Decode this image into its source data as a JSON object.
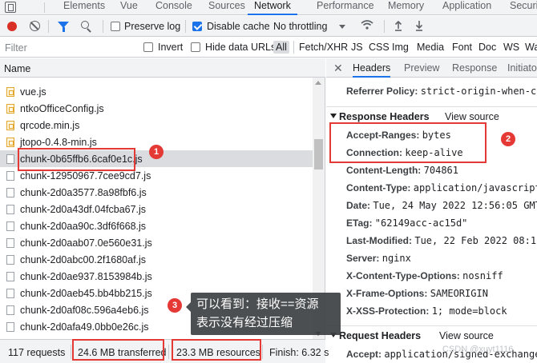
{
  "panel_tabs": [
    "Elements",
    "Vue",
    "Console",
    "Sources",
    "Network",
    "Performance",
    "Memory",
    "Application",
    "Securi"
  ],
  "toolbar": {
    "preserve_log": "Preserve log",
    "disable_cache": "Disable cache",
    "throttle": "No throttling"
  },
  "filterbar": {
    "placeholder": "Filter",
    "invert": "Invert",
    "hide_data_urls": "Hide data URLs",
    "types": [
      "All",
      "Fetch/XHR",
      "JS",
      "CSS",
      "Img",
      "Media",
      "Font",
      "Doc",
      "WS",
      "Wa"
    ]
  },
  "list": {
    "header": "Name",
    "rows": [
      "vue.js",
      "ntkoOfficeConfig.js",
      "qrcode.min.js",
      "jtopo-0.4.8-min.js",
      "chunk-0b65ffb6.6caf0e1c.js",
      "chunk-12950967.7cee9cd7.js",
      "chunk-2d0a3577.8a98fbf6.js",
      "chunk-2d0a43df.04fcba67.js",
      "chunk-2d0aa90c.3df6f668.js",
      "chunk-2d0aab07.0e560e31.js",
      "chunk-2d0abc00.2f1680af.js",
      "chunk-2d0ae937.8153984b.js",
      "chunk-2d0aeb45.bb4bb215.js",
      "chunk-2d0af08c.596a4eb6.js",
      "chunk-2d0afa49.0bb0e26c.js"
    ]
  },
  "status": {
    "requests": "117 requests",
    "transferred": "24.6 MB transferred",
    "resources": "23.3 MB resources",
    "finish": "Finish: 6.32 s"
  },
  "right": {
    "tabs": [
      "Headers",
      "Preview",
      "Response",
      "Initiator"
    ],
    "referrer_key": "Referrer Policy:",
    "referrer_val": "strict-origin-when-cro",
    "response_headers_title": "Response Headers",
    "view_source": "View source",
    "response_headers": [
      {
        "k": "Accept-Ranges:",
        "v": "bytes"
      },
      {
        "k": "Connection:",
        "v": "keep-alive"
      },
      {
        "k": "Content-Length:",
        "v": "704861"
      },
      {
        "k": "Content-Type:",
        "v": "application/javascript"
      },
      {
        "k": "Date:",
        "v": "Tue, 24 May 2022 12:56:05 GMT"
      },
      {
        "k": "ETag:",
        "v": "\"62149acc-ac15d\""
      },
      {
        "k": "Last-Modified:",
        "v": "Tue, 22 Feb 2022 08:11:"
      },
      {
        "k": "Server:",
        "v": "nginx"
      },
      {
        "k": "X-Content-Type-Options:",
        "v": "nosniff"
      },
      {
        "k": "X-Frame-Options:",
        "v": "SAMEORIGIN"
      },
      {
        "k": "X-XSS-Protection:",
        "v": "1; mode=block"
      }
    ],
    "request_headers_title": "Request Headers",
    "accept_key": "Accept:",
    "accept_val": "application/signed-exchange;v=b"
  },
  "annotations": {
    "badge1": "1",
    "badge2": "2",
    "badge3": "3",
    "tooltip_line1": "可以看到：接收==资源",
    "tooltip_line2": "表示没有经过压缩"
  },
  "watermark": "CSDN @xuyt1116",
  "colors": {
    "accent": "#1a73e8",
    "annotation": "#e53935",
    "record": "#d93025"
  }
}
